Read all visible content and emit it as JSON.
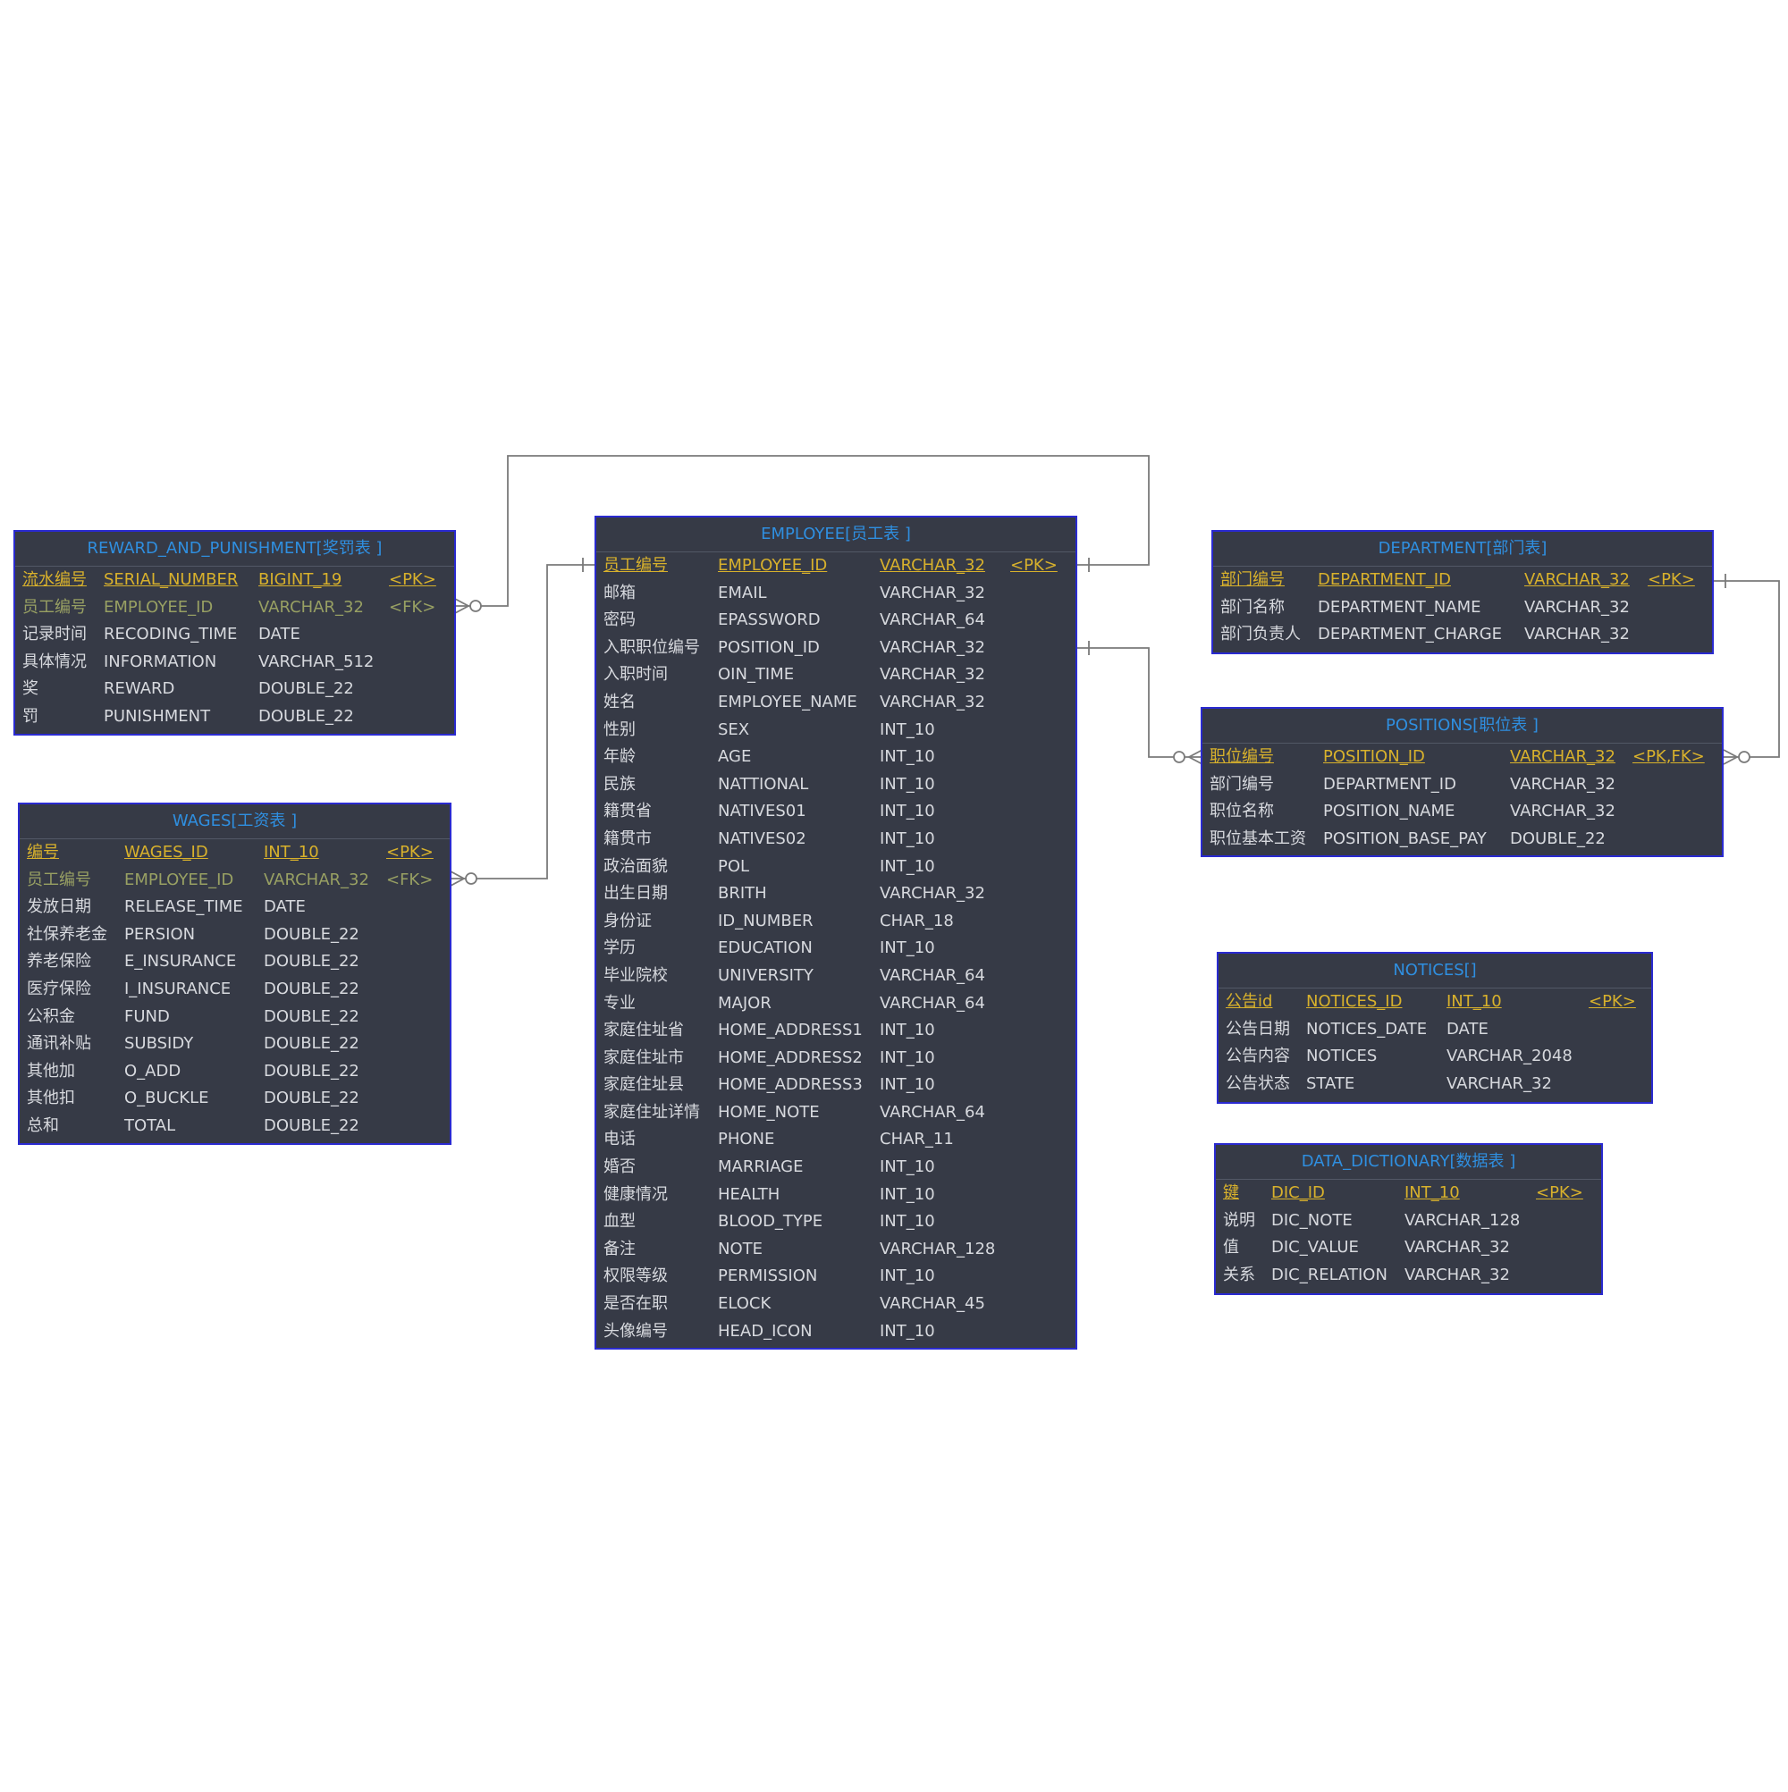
{
  "colors": {
    "background": "#ffffff",
    "entity_fill": "#363a46",
    "entity_border": "#2a2ad0",
    "title": "#2f8fe0",
    "text": "#d7d9de",
    "primary_key": "#d8b12c",
    "foreign_key": "#98a063",
    "connector": "#7a7a7a"
  },
  "entities": {
    "reward": {
      "title": "REWARD_AND_PUNISHMENT[奖罚表 ]",
      "columns": [
        {
          "cn": "流水编号",
          "en": "SERIAL_NUMBER",
          "type": "BIGINT_19",
          "key": "<PK>",
          "kind": "pk"
        },
        {
          "cn": "员工编号",
          "en": "EMPLOYEE_ID",
          "type": "VARCHAR_32",
          "key": "<FK>",
          "kind": "fk"
        },
        {
          "cn": "记录时间",
          "en": "RECODING_TIME",
          "type": "DATE",
          "key": "",
          "kind": ""
        },
        {
          "cn": "具体情况",
          "en": "INFORMATION",
          "type": "VARCHAR_512",
          "key": "",
          "kind": ""
        },
        {
          "cn": "奖",
          "en": "REWARD",
          "type": "DOUBLE_22",
          "key": "",
          "kind": ""
        },
        {
          "cn": "罚",
          "en": "PUNISHMENT",
          "type": "DOUBLE_22",
          "key": "",
          "kind": ""
        }
      ]
    },
    "wages": {
      "title": "WAGES[工资表 ]",
      "columns": [
        {
          "cn": "编号",
          "en": "WAGES_ID",
          "type": "INT_10",
          "key": "<PK>",
          "kind": "pk"
        },
        {
          "cn": "员工编号",
          "en": "EMPLOYEE_ID",
          "type": "VARCHAR_32",
          "key": "<FK>",
          "kind": "fk"
        },
        {
          "cn": "发放日期",
          "en": "RELEASE_TIME",
          "type": "DATE",
          "key": "",
          "kind": ""
        },
        {
          "cn": "社保养老金",
          "en": "PERSION",
          "type": "DOUBLE_22",
          "key": "",
          "kind": ""
        },
        {
          "cn": "养老保险",
          "en": "E_INSURANCE",
          "type": "DOUBLE_22",
          "key": "",
          "kind": ""
        },
        {
          "cn": "医疗保险",
          "en": "I_INSURANCE",
          "type": "DOUBLE_22",
          "key": "",
          "kind": ""
        },
        {
          "cn": "公积金",
          "en": "FUND",
          "type": "DOUBLE_22",
          "key": "",
          "kind": ""
        },
        {
          "cn": "通讯补贴",
          "en": "SUBSIDY",
          "type": "DOUBLE_22",
          "key": "",
          "kind": ""
        },
        {
          "cn": "其他加",
          "en": "O_ADD",
          "type": "DOUBLE_22",
          "key": "",
          "kind": ""
        },
        {
          "cn": "其他扣",
          "en": "O_BUCKLE",
          "type": "DOUBLE_22",
          "key": "",
          "kind": ""
        },
        {
          "cn": "总和",
          "en": "TOTAL",
          "type": "DOUBLE_22",
          "key": "",
          "kind": ""
        }
      ]
    },
    "employee": {
      "title": "EMPLOYEE[员工表 ]",
      "columns": [
        {
          "cn": "员工编号",
          "en": "EMPLOYEE_ID",
          "type": "VARCHAR_32",
          "key": "<PK>",
          "kind": "pk"
        },
        {
          "cn": "邮箱",
          "en": "EMAIL",
          "type": "VARCHAR_32",
          "key": "",
          "kind": ""
        },
        {
          "cn": "密码",
          "en": "EPASSWORD",
          "type": "VARCHAR_64",
          "key": "",
          "kind": ""
        },
        {
          "cn": "入职职位编号",
          "en": "POSITION_ID",
          "type": "VARCHAR_32",
          "key": "",
          "kind": ""
        },
        {
          "cn": "入职时间",
          "en": "OIN_TIME",
          "type": "VARCHAR_32",
          "key": "",
          "kind": ""
        },
        {
          "cn": "姓名",
          "en": "EMPLOYEE_NAME",
          "type": "VARCHAR_32",
          "key": "",
          "kind": ""
        },
        {
          "cn": "性别",
          "en": "SEX",
          "type": "INT_10",
          "key": "",
          "kind": ""
        },
        {
          "cn": "年龄",
          "en": "AGE",
          "type": "INT_10",
          "key": "",
          "kind": ""
        },
        {
          "cn": "民族",
          "en": "NATTIONAL",
          "type": "INT_10",
          "key": "",
          "kind": ""
        },
        {
          "cn": "籍贯省",
          "en": "NATIVES01",
          "type": "INT_10",
          "key": "",
          "kind": ""
        },
        {
          "cn": "籍贯市",
          "en": "NATIVES02",
          "type": "INT_10",
          "key": "",
          "kind": ""
        },
        {
          "cn": "政治面貌",
          "en": "POL",
          "type": "INT_10",
          "key": "",
          "kind": ""
        },
        {
          "cn": "出生日期",
          "en": "BRITH",
          "type": "VARCHAR_32",
          "key": "",
          "kind": ""
        },
        {
          "cn": "身份证",
          "en": "ID_NUMBER",
          "type": "CHAR_18",
          "key": "",
          "kind": ""
        },
        {
          "cn": "学历",
          "en": "EDUCATION",
          "type": "INT_10",
          "key": "",
          "kind": ""
        },
        {
          "cn": "毕业院校",
          "en": "UNIVERSITY",
          "type": "VARCHAR_64",
          "key": "",
          "kind": ""
        },
        {
          "cn": "专业",
          "en": "MAJOR",
          "type": "VARCHAR_64",
          "key": "",
          "kind": ""
        },
        {
          "cn": "家庭住址省",
          "en": "HOME_ADDRESS1",
          "type": "INT_10",
          "key": "",
          "kind": ""
        },
        {
          "cn": "家庭住址市",
          "en": "HOME_ADDRESS2",
          "type": "INT_10",
          "key": "",
          "kind": ""
        },
        {
          "cn": "家庭住址县",
          "en": "HOME_ADDRESS3",
          "type": "INT_10",
          "key": "",
          "kind": ""
        },
        {
          "cn": "家庭住址详情",
          "en": "HOME_NOTE",
          "type": "VARCHAR_64",
          "key": "",
          "kind": ""
        },
        {
          "cn": "电话",
          "en": "PHONE",
          "type": "CHAR_11",
          "key": "",
          "kind": ""
        },
        {
          "cn": "婚否",
          "en": "MARRIAGE",
          "type": "INT_10",
          "key": "",
          "kind": ""
        },
        {
          "cn": "健康情况",
          "en": "HEALTH",
          "type": "INT_10",
          "key": "",
          "kind": ""
        },
        {
          "cn": "血型",
          "en": "BLOOD_TYPE",
          "type": "INT_10",
          "key": "",
          "kind": ""
        },
        {
          "cn": "备注",
          "en": "NOTE",
          "type": "VARCHAR_128",
          "key": "",
          "kind": ""
        },
        {
          "cn": "权限等级",
          "en": "PERMISSION",
          "type": "INT_10",
          "key": "",
          "kind": ""
        },
        {
          "cn": "是否在职",
          "en": "ELOCK",
          "type": "VARCHAR_45",
          "key": "",
          "kind": ""
        },
        {
          "cn": "头像编号",
          "en": "HEAD_ICON",
          "type": "INT_10",
          "key": "",
          "kind": ""
        }
      ]
    },
    "department": {
      "title": "DEPARTMENT[部门表]",
      "columns": [
        {
          "cn": "部门编号",
          "en": "DEPARTMENT_ID",
          "type": "VARCHAR_32",
          "key": "<PK>",
          "kind": "pk"
        },
        {
          "cn": "部门名称",
          "en": "DEPARTMENT_NAME",
          "type": "VARCHAR_32",
          "key": "",
          "kind": ""
        },
        {
          "cn": "部门负责人",
          "en": "DEPARTMENT_CHARGE",
          "type": "VARCHAR_32",
          "key": "",
          "kind": ""
        }
      ]
    },
    "positions": {
      "title": "POSITIONS[职位表 ]",
      "columns": [
        {
          "cn": "职位编号",
          "en": "POSITION_ID",
          "type": "VARCHAR_32",
          "key": "<PK,FK>",
          "kind": "pk"
        },
        {
          "cn": "部门编号",
          "en": "DEPARTMENT_ID",
          "type": "VARCHAR_32",
          "key": "",
          "kind": ""
        },
        {
          "cn": "职位名称",
          "en": "POSITION_NAME",
          "type": "VARCHAR_32",
          "key": "",
          "kind": ""
        },
        {
          "cn": "职位基本工资",
          "en": "POSITION_BASE_PAY",
          "type": "DOUBLE_22",
          "key": "",
          "kind": ""
        }
      ]
    },
    "notices": {
      "title": "NOTICES[]",
      "columns": [
        {
          "cn": "公告id",
          "en": "NOTICES_ID",
          "type": "INT_10",
          "key": "<PK>",
          "kind": "pk"
        },
        {
          "cn": "公告日期",
          "en": "NOTICES_DATE",
          "type": "DATE",
          "key": "",
          "kind": ""
        },
        {
          "cn": "公告内容",
          "en": "NOTICES",
          "type": "VARCHAR_2048",
          "key": "",
          "kind": ""
        },
        {
          "cn": "公告状态",
          "en": "STATE",
          "type": "VARCHAR_32",
          "key": "",
          "kind": ""
        }
      ]
    },
    "dictionary": {
      "title": "DATA_DICTIONARY[数据表 ]",
      "columns": [
        {
          "cn": "键",
          "en": "DIC_ID",
          "type": "INT_10",
          "key": "<PK>",
          "kind": "pk"
        },
        {
          "cn": "说明",
          "en": "DIC_NOTE",
          "type": "VARCHAR_128",
          "key": "",
          "kind": ""
        },
        {
          "cn": "值",
          "en": "DIC_VALUE",
          "type": "VARCHAR_32",
          "key": "",
          "kind": ""
        },
        {
          "cn": "关系",
          "en": "DIC_RELATION",
          "type": "VARCHAR_32",
          "key": "",
          "kind": ""
        }
      ]
    }
  }
}
